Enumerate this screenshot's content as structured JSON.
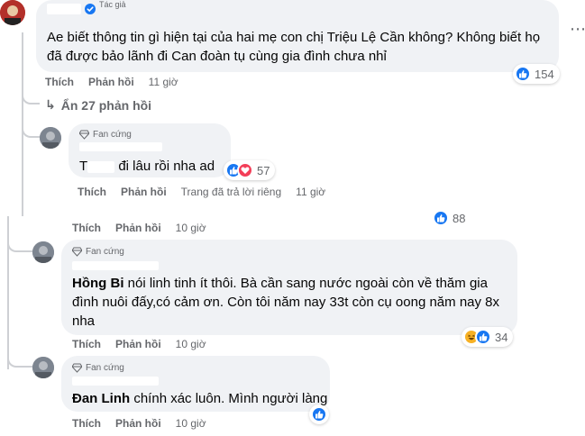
{
  "top_comment": {
    "header_fragment": "Tác giả",
    "text": "Ae biết thông tin gì hiện tại của hai mẹ con chị Triệu Lệ Cần không? Không biết họ đã được bảo lãnh đi Can đoàn tụ cùng gia đình chưa nhỉ",
    "reaction_count": "154",
    "like_label": "Thích",
    "reply_label": "Phản hồi",
    "time": "11 giờ"
  },
  "hide_replies": {
    "label": "Ẩn 27 phản hồi"
  },
  "reply1": {
    "badge": "Fan cứng",
    "author_fragment": "T",
    "text": "đi lâu rồi nha ad",
    "reaction_count": "57",
    "like_label": "Thích",
    "reply_label": "Phản hồi",
    "status": "Trang đã trả lời riêng",
    "time": "11 giờ"
  },
  "reply_prev": {
    "like_label": "Thích",
    "reply_label": "Phản hồi",
    "time": "10 giờ",
    "reaction_count": "88"
  },
  "reply2": {
    "badge": "Fan cứng",
    "mention": "Hồng Bi",
    "text": " nói linh tinh ít thôi. Bà cần sang nước ngoài còn về thăm gia đình nuôi đấy,có cảm ơn. Còn tôi năm nay 33t còn cụ oong năm nay 8x nha",
    "reaction_count": "34",
    "like_label": "Thích",
    "reply_label": "Phản hồi",
    "time": "10 giờ"
  },
  "reply3": {
    "badge": "Fan cứng",
    "mention": "Đan Linh",
    "text": " chính xác luôn. Mình người làng",
    "like_label": "Thích",
    "reply_label": "Phản hồi",
    "time": "10 giờ"
  },
  "colors": {
    "bubble": "#f0f2f5",
    "secondary_text": "#65676b",
    "like_blue": "#1877f2",
    "love_red": "#f33e58",
    "haha_yellow": "#f7b125",
    "thread_line": "#ced0d4"
  },
  "icons": [
    "verified-badge-icon",
    "diamond-icon",
    "like-icon",
    "love-icon",
    "haha-icon",
    "more-options-icon",
    "avatar"
  ]
}
